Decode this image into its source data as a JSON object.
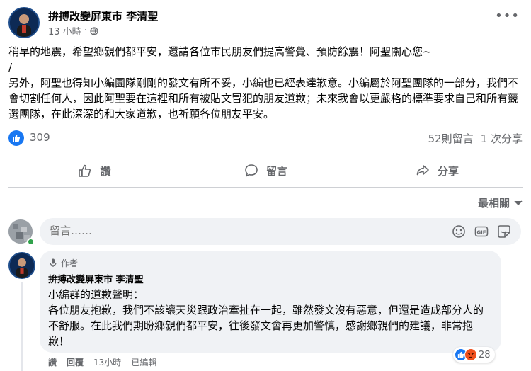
{
  "post": {
    "author": "拚搏改變屏東市 李清聖",
    "time": "13 小時",
    "separator": "·",
    "paragraphs": [
      "稍早的地震，希望鄉親們都平安，還請各位市民朋友們提高警覺、預防餘震！阿聖關心您~",
      "/",
      "另外，阿聖也得知小編團隊剛剛的發文有所不妥，小編也已經表達歉意。小編屬於阿聖團隊的一部分，我們不會切割任何人，因此阿聖要在這裡和所有被貼文冒犯的朋友道歉；未來我會以更嚴格的標準要求自己和所有競選團隊，在此深深的和大家道歉，也祈願各位朋友平安。"
    ],
    "like_count": "309",
    "comments_count": "52則留言",
    "shares_count": "1 次分享"
  },
  "actions": {
    "like": "讚",
    "comment": "留言",
    "share": "分享"
  },
  "sort": {
    "label": "最相關"
  },
  "composer": {
    "placeholder": "留言……"
  },
  "comment": {
    "author_tag": "作者",
    "author": "拚搏改變屏東市 李清聖",
    "lines": [
      "小編群的道歉聲明：",
      "各位朋友抱歉，我們不該讓天災跟政治牽扯在一起，雖然發文沒有惡意，但還是造成部分人的不舒服。在此我們期盼鄉親們都平安，往後發文會再更加警慎，感謝鄉親們的建議，非常抱歉！"
    ],
    "reaction_count": "28",
    "like_label": "讚",
    "reply_label": "回覆",
    "time": "13小時",
    "edited": "已編輯"
  },
  "colors": {
    "accent": "#1877f2",
    "muted": "#65676b",
    "bubble": "#f0f2f5",
    "online": "#31a24c",
    "angry": "#f0501e"
  }
}
